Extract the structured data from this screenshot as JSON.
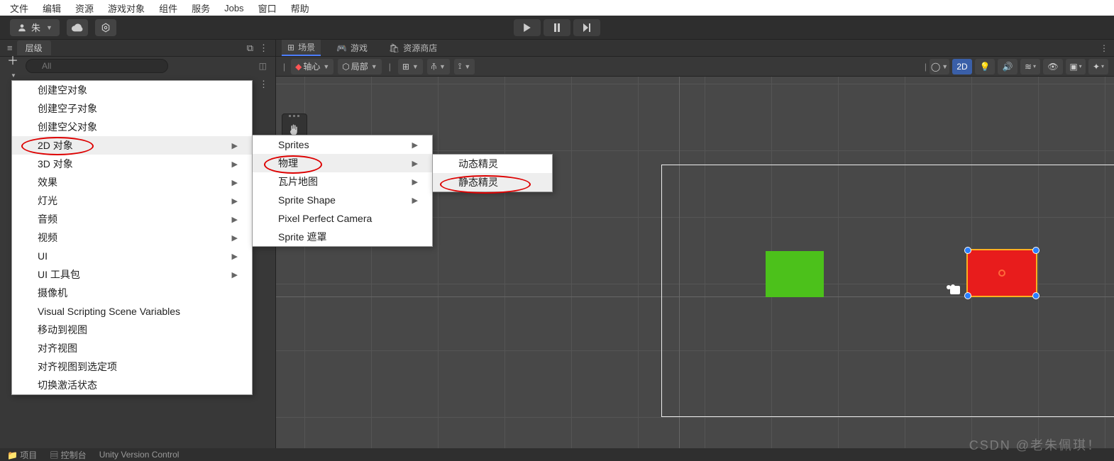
{
  "menu": {
    "items": [
      "文件",
      "编辑",
      "资源",
      "游戏对象",
      "组件",
      "服务",
      "Jobs",
      "窗口",
      "帮助"
    ]
  },
  "toolbar": {
    "user": "朱"
  },
  "hierarchy": {
    "title": "层级",
    "search_placeholder": "All"
  },
  "scene_tabs": {
    "scene": "场景",
    "game": "游戏",
    "store": "资源商店"
  },
  "scene_toolbar": {
    "pivot": "轴心",
    "local": "局部",
    "btn_2d": "2D"
  },
  "context_menu_1": {
    "items": [
      {
        "label": "创建空对象"
      },
      {
        "label": "创建空子对象"
      },
      {
        "label": "创建空父对象"
      },
      {
        "label": "2D 对象",
        "arrow": true,
        "hl": true,
        "annot": true
      },
      {
        "label": "3D 对象",
        "arrow": true
      },
      {
        "label": "效果",
        "arrow": true
      },
      {
        "label": "灯光",
        "arrow": true
      },
      {
        "label": "音频",
        "arrow": true
      },
      {
        "label": "视频",
        "arrow": true
      },
      {
        "label": "UI",
        "arrow": true
      },
      {
        "label": "UI 工具包",
        "arrow": true
      },
      {
        "label": "摄像机"
      },
      {
        "label": "Visual Scripting Scene Variables"
      },
      {
        "label": "移动到视图"
      },
      {
        "label": "对齐视图"
      },
      {
        "label": "对齐视图到选定项"
      },
      {
        "label": "切换激活状态"
      }
    ]
  },
  "context_menu_2": {
    "items": [
      {
        "label": "Sprites",
        "arrow": true
      },
      {
        "label": "物理",
        "arrow": true,
        "hl": true,
        "annot": true
      },
      {
        "label": "瓦片地图",
        "arrow": true
      },
      {
        "label": "Sprite Shape",
        "arrow": true
      },
      {
        "label": "Pixel Perfect Camera"
      },
      {
        "label": "Sprite 遮罩"
      }
    ]
  },
  "context_menu_3": {
    "items": [
      {
        "label": "动态精灵"
      },
      {
        "label": "静态精灵",
        "hl": true,
        "annot": true
      }
    ]
  },
  "bottom": {
    "project": "项目",
    "console": "控制台",
    "uvc": "Unity Version Control"
  },
  "watermark": "CSDN @老朱佩琪！"
}
